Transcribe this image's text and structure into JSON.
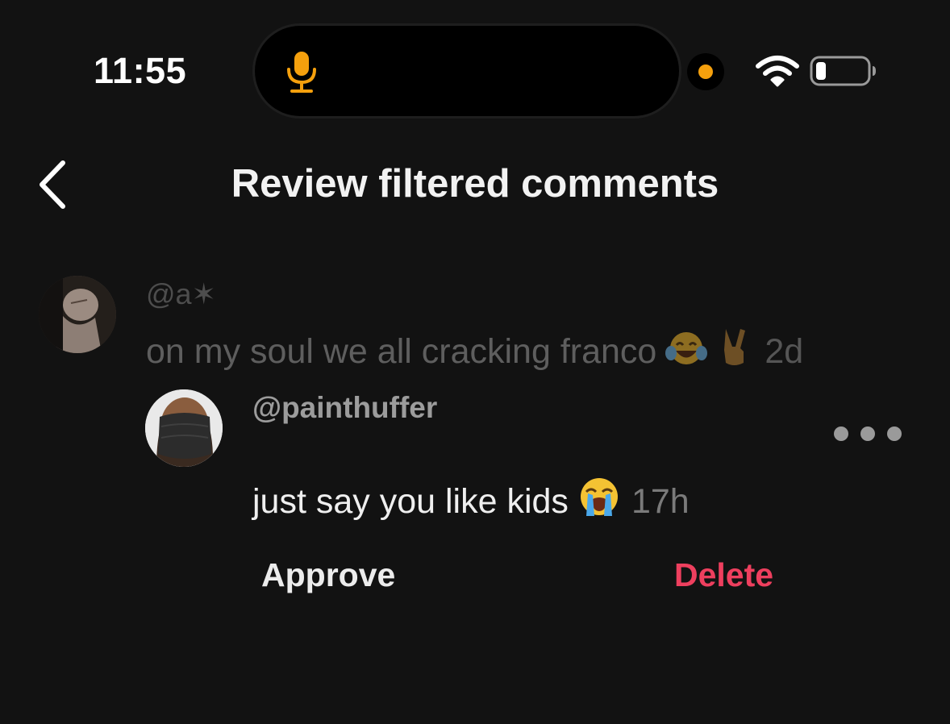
{
  "status_bar": {
    "time": "11:55",
    "mic_color": "#f5a00d",
    "camera_indicator_color": "#f5a00d",
    "icons": [
      "microphone-icon",
      "camera-indicator-icon",
      "wifi-icon",
      "battery-icon"
    ]
  },
  "header": {
    "title": "Review filtered comments",
    "back_icon": "chevron-left-icon"
  },
  "comments": [
    {
      "username": "@a✶",
      "text": "on my soul we all cracking franco",
      "emojis": [
        "face-with-tears-of-joy",
        "victory-hand"
      ],
      "time": "2d",
      "dimmed": true
    }
  ],
  "filtered_reply": {
    "username": "@painthuffer",
    "text": "just say you like kids",
    "emoji": "loudly-crying-face",
    "time": "17h",
    "more_icon": "more-dots-icon"
  },
  "actions": {
    "approve_label": "Approve",
    "delete_label": "Delete",
    "delete_color": "#ee3f5e"
  }
}
